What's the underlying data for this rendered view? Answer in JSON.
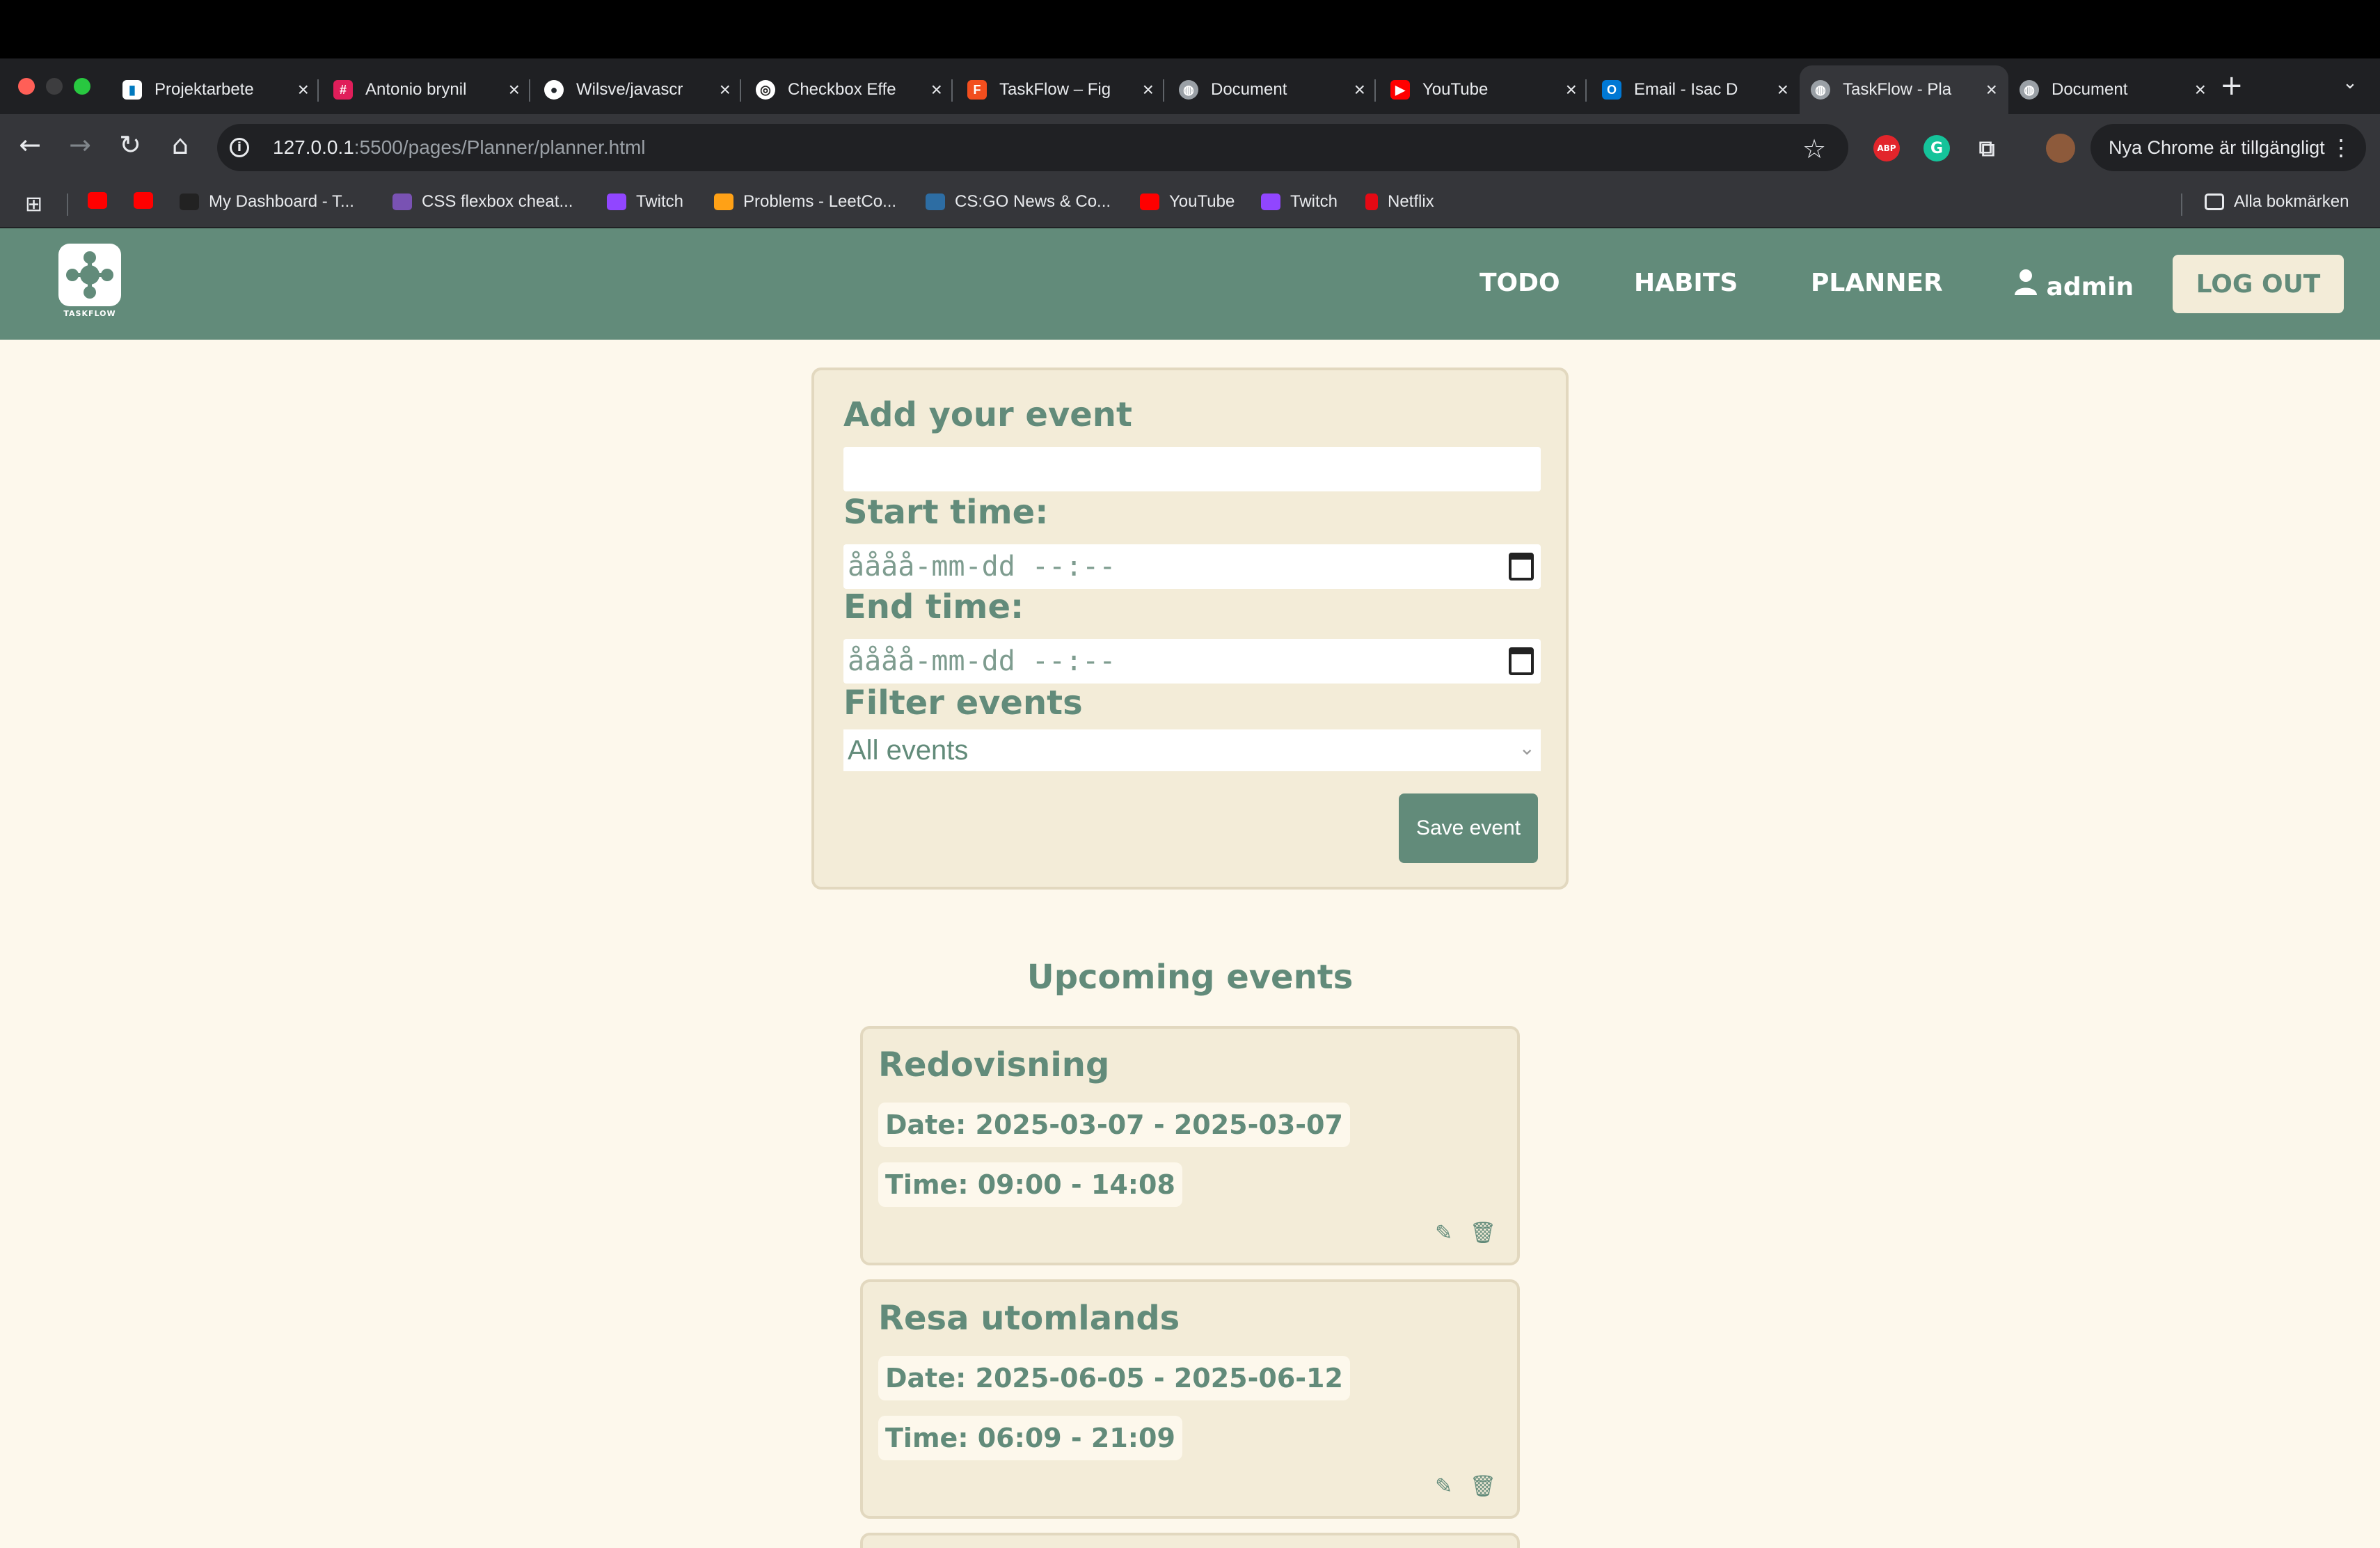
{
  "browser": {
    "tabs": [
      {
        "title": "Projektarbete",
        "icon": "trello-icon",
        "color": "#0079bf"
      },
      {
        "title": "Antonio brynil",
        "icon": "slack-icon",
        "color": "#4a154b"
      },
      {
        "title": "Wilsve/javascr",
        "icon": "github-icon",
        "color": "#24292e"
      },
      {
        "title": "Checkbox Effe",
        "icon": "codepen-icon",
        "color": "#444444"
      },
      {
        "title": "TaskFlow – Fig",
        "icon": "figma-icon",
        "color": "#f24e1e"
      },
      {
        "title": "Document",
        "icon": "globe-icon",
        "color": "#5f6368"
      },
      {
        "title": "YouTube",
        "icon": "youtube-icon",
        "color": "#ff0000"
      },
      {
        "title": "Email - Isac D",
        "icon": "outlook-icon",
        "color": "#0078d4"
      },
      {
        "title": "TaskFlow - Pla",
        "icon": "globe-icon",
        "color": "#5f6368"
      },
      {
        "title": "Document",
        "icon": "globe-icon",
        "color": "#5f6368"
      }
    ],
    "active_tab_index": 8,
    "url_host": "127.0.0.1",
    "url_rest": ":5500/pages/Planner/planner.html",
    "update_text": "Nya Chrome är tillgängligt",
    "bookmarks": [
      {
        "label": "",
        "icon": "youtube-icon",
        "color": "#ff0000"
      },
      {
        "label": "",
        "icon": "youtube-icon",
        "color": "#ff0000"
      },
      {
        "label": "My Dashboard - T...",
        "icon": "dashboard-icon",
        "color": "#222222"
      },
      {
        "label": "CSS flexbox cheat...",
        "icon": "bootstrap-icon",
        "color": "#7952b3"
      },
      {
        "label": "Twitch",
        "icon": "twitch-icon",
        "color": "#9146ff"
      },
      {
        "label": "Problems - LeetCo...",
        "icon": "leetcode-icon",
        "color": "#ffa116"
      },
      {
        "label": "CS:GO News & Co...",
        "icon": "hltv-icon",
        "color": "#2d6da3"
      },
      {
        "label": "YouTube",
        "icon": "youtube-icon",
        "color": "#ff0000"
      },
      {
        "label": "Twitch",
        "icon": "twitch-icon",
        "color": "#9146ff"
      },
      {
        "label": "Netflix",
        "icon": "netflix-icon",
        "color": "#e50914"
      }
    ],
    "all_bookmarks_label": "Alla bokmärken"
  },
  "app": {
    "logo_text": "TASKFLOW",
    "nav": {
      "todo": "TODO",
      "habits": "HABITS",
      "planner": "PLANNER",
      "user": "admin",
      "logout": "LOG OUT"
    },
    "form": {
      "title_label": "Add your event",
      "title_value": "",
      "start_label": "Start time:",
      "start_placeholder": "åååå-mm-dd --:--",
      "end_label": "End time:",
      "end_placeholder": "åååå-mm-dd --:--",
      "filter_label": "Filter events",
      "filter_selected": "All events",
      "save_label": "Save event"
    },
    "upcoming_heading": "Upcoming events",
    "events": [
      {
        "title": "Redovisning",
        "date": "Date: 2025-03-07 - 2025-03-07",
        "time": "Time: 09:00 - 14:08"
      },
      {
        "title": "Resa utomlands",
        "date": "Date: 2025-06-05 - 2025-06-12",
        "time": "Time: 06:09 - 21:09"
      }
    ],
    "colors": {
      "primary": "#628b7a",
      "card": "#f3ecd8",
      "background": "#fdf8ec"
    }
  }
}
